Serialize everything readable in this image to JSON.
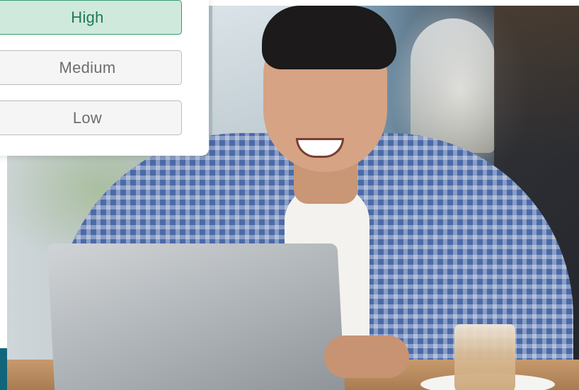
{
  "priority_selector": {
    "options": [
      {
        "label": "High",
        "selected": true
      },
      {
        "label": "Medium",
        "selected": false
      },
      {
        "label": "Low",
        "selected": false
      }
    ],
    "selected_color": "#cfe9dc",
    "selected_border_color": "#3a9a72",
    "selected_text_color": "#1f7a55",
    "unselected_color": "#f5f5f5"
  },
  "photo": {
    "subject": "man-smiling-at-laptop"
  },
  "accent_color": "#11657a"
}
